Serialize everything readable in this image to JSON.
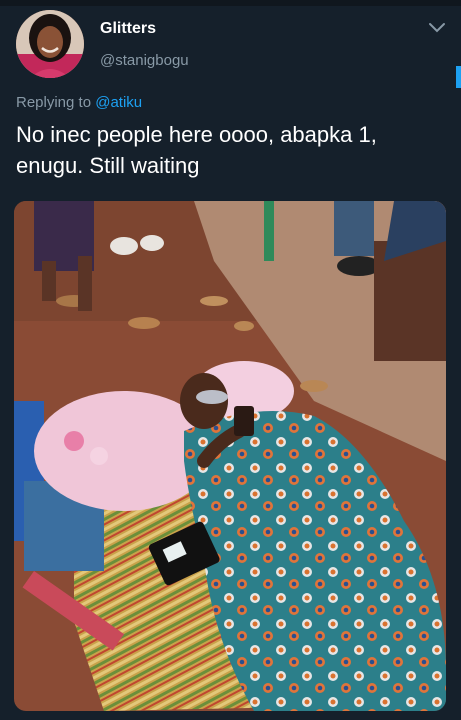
{
  "tweet": {
    "display_name": "Glitters",
    "handle": "@stanigbogu",
    "replying_prefix": "Replying to",
    "replying_to": "@atiku",
    "text": "No inec people here oooo, abapka 1, enugu. Still waiting"
  },
  "icons": {
    "menu": "chevron-down-icon"
  },
  "colors": {
    "background": "#15202b",
    "accent": "#1da1f2",
    "secondary_text": "#8899a6"
  }
}
